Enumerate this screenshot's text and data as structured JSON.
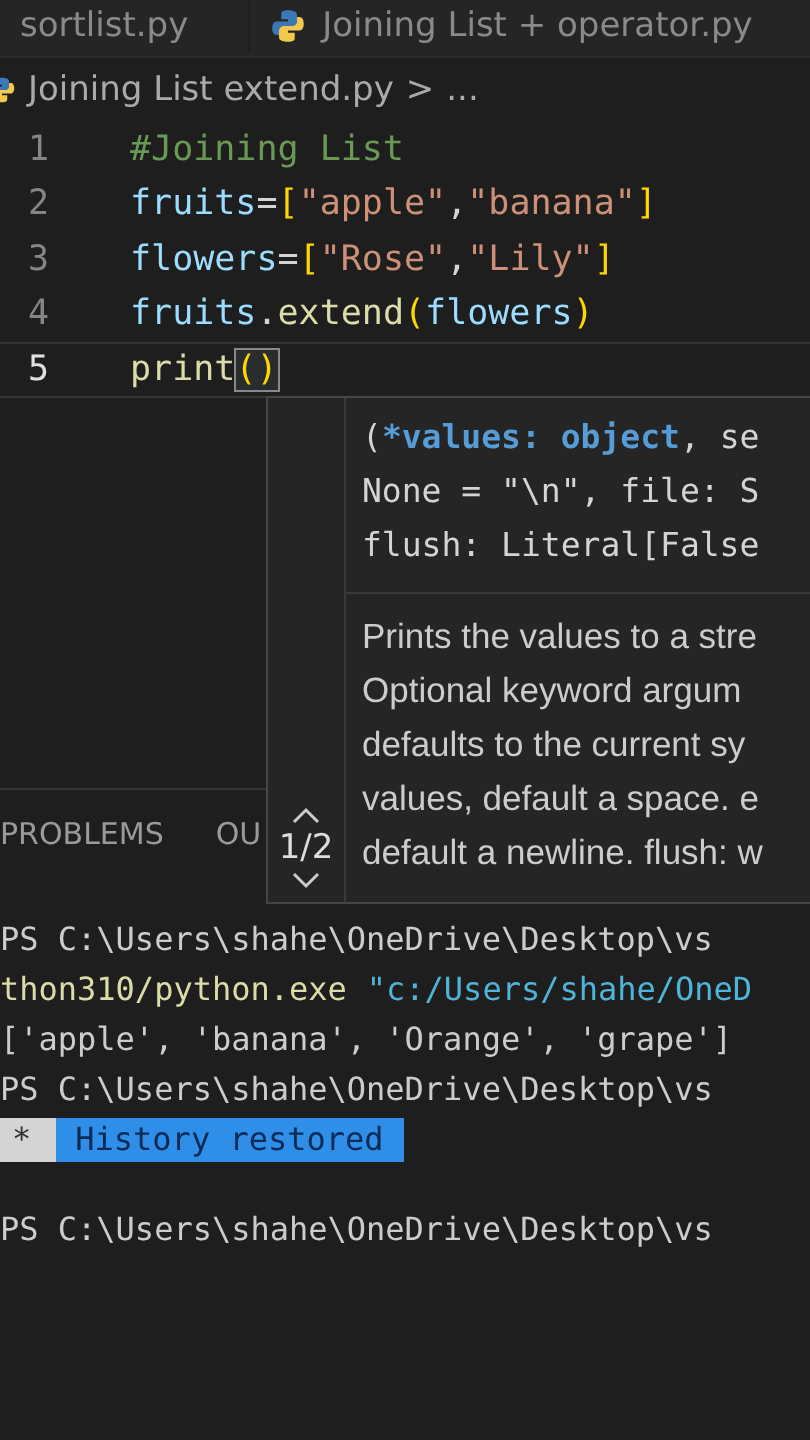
{
  "editor_tabs": [
    {
      "label": "sortlist.py",
      "icon": false,
      "selected": false
    },
    {
      "label": "Joining List + operator.py",
      "icon": true,
      "selected": false
    }
  ],
  "breadcrumb": {
    "file": "Joining List extend.py",
    "separator": ">",
    "more": "..."
  },
  "code_lines": [
    {
      "number": "1",
      "selected": false,
      "tokens": [
        {
          "kind": "comment",
          "text": "#Joining List"
        }
      ]
    },
    {
      "number": "2",
      "selected": false,
      "tokens": [
        {
          "kind": "var",
          "text": "fruits"
        },
        {
          "kind": "op",
          "text": "="
        },
        {
          "kind": "bracket",
          "text": "["
        },
        {
          "kind": "string",
          "text": "\"apple\""
        },
        {
          "kind": "op",
          "text": ","
        },
        {
          "kind": "string",
          "text": "\"banana\""
        },
        {
          "kind": "bracket",
          "text": "]"
        }
      ]
    },
    {
      "number": "3",
      "selected": false,
      "tokens": [
        {
          "kind": "var",
          "text": "flowers"
        },
        {
          "kind": "op",
          "text": "="
        },
        {
          "kind": "bracket",
          "text": "["
        },
        {
          "kind": "string",
          "text": "\"Rose\""
        },
        {
          "kind": "op",
          "text": ","
        },
        {
          "kind": "string",
          "text": "\"Lily\""
        },
        {
          "kind": "bracket",
          "text": "]"
        }
      ]
    },
    {
      "number": "4",
      "selected": false,
      "tokens": [
        {
          "kind": "var",
          "text": "fruits"
        },
        {
          "kind": "op",
          "text": "."
        },
        {
          "kind": "func",
          "text": "extend"
        },
        {
          "kind": "bracket",
          "text": "("
        },
        {
          "kind": "var",
          "text": "flowers"
        },
        {
          "kind": "bracket",
          "text": ")"
        }
      ]
    },
    {
      "number": "5",
      "selected": true,
      "tokens": [
        {
          "kind": "func",
          "text": "print"
        },
        {
          "kind": "match",
          "text": "()"
        }
      ]
    }
  ],
  "hover": {
    "signature": [
      [
        {
          "kind": "op",
          "text": "("
        },
        {
          "kind": "param",
          "text": "*values: object"
        },
        {
          "kind": "op",
          "text": ", se"
        }
      ],
      [
        {
          "kind": "op",
          "text": "None = \"\\n\", file: S"
        }
      ],
      [
        {
          "kind": "op",
          "text": "flush: Literal[False"
        }
      ]
    ],
    "documentation": [
      "Prints the values to a stre",
      "Optional keyword argum",
      "defaults to the current sy",
      "values, default a space. e",
      "default a newline. flush: w"
    ],
    "page": "1/2"
  },
  "panel_tabs": [
    {
      "label": "PROBLEMS",
      "selected": false
    },
    {
      "label": "OU",
      "selected": false
    }
  ],
  "terminal_lines": [
    [
      {
        "kind": "plain",
        "text": "PS C:\\Users\\shahe\\OneDrive\\Desktop\\vs"
      }
    ],
    [
      {
        "kind": "command",
        "text": "thon310/python.exe"
      },
      {
        "kind": "arg",
        "text": "\"c:/Users/shahe/OneD"
      }
    ],
    [
      {
        "kind": "plain",
        "text": "['apple', 'banana', 'Orange', 'grape']"
      }
    ],
    [
      {
        "kind": "plain",
        "text": "PS C:\\Users\\shahe\\OneDrive\\Desktop\\vs"
      }
    ],
    [
      {
        "kind": "marker",
        "text": "*"
      },
      {
        "kind": "notice",
        "text": "History restored"
      }
    ],
    [
      {
        "kind": "plain",
        "text": "PS C:\\Users\\shahe\\OneDrive\\Desktop\\vs"
      }
    ]
  ]
}
